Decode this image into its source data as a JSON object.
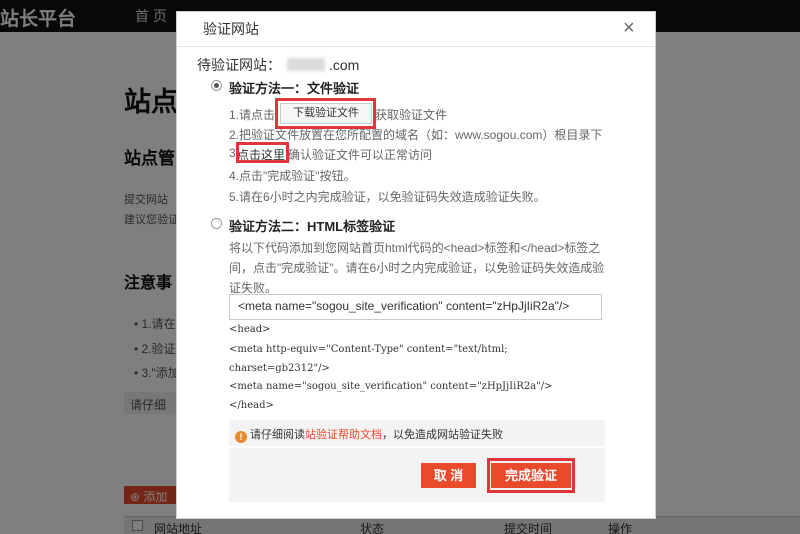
{
  "background": {
    "logo": "站长平台",
    "nav_first": "首 页",
    "heading": "站点",
    "subheading": "站点管",
    "text_line1": "提交网站",
    "text_line2": "建议您验证",
    "notes_heading": "注意事",
    "note_items": [
      "• 1.请在6",
      "• 2.验证站",
      "• 3.\"添加网"
    ],
    "tip": "请仔细",
    "add_button": "⊕ 添加",
    "table_headers": {
      "site": "网站地址",
      "status": "状态",
      "time": "提交时间",
      "action": "操作"
    }
  },
  "modal": {
    "title": "验证网站",
    "close": "×",
    "site_label_prefix": "待验证网站：",
    "site_label_suffix": ".com",
    "method1": {
      "title": "验证方法一：文件验证",
      "step1_prefix": "1.请点击",
      "download_button": "下载验证文件",
      "step1_suffix": "获取验证文件",
      "step2": "2.把验证文件放置在您所配置的域名（如：www.sogou.com）根目录下",
      "step3_number": "3.",
      "click_here": "点击这里",
      "step3_suffix": "确认验证文件可以正常访问",
      "step4": "4.点击\"完成验证\"按钮。",
      "step5": "5.请在6小时之内完成验证，以免验证码失效造成验证失败。"
    },
    "method2": {
      "title": "验证方法二：HTML标签验证",
      "description": "将以下代码添加到您网站首页html代码的<head>标签和</head>标签之间，点击\"完成验证\"。请在6小时之内完成验证，以免验证码失效造成验证失败。",
      "meta_input_value": "<meta name=\"sogou_site_verification\" content=\"zHpJjIiR2a\"/>",
      "code_lines": [
        "<head>",
        "<meta http-equiv=\"Content-Type\" content=\"text/html;",
        "charset=gb2312\"/>",
        "<meta name=\"sogou_site_verification\" content=\"zHpJjIiR2a\"/>",
        "</head>"
      ]
    },
    "notice_prefix": "请仔细阅读",
    "notice_link": "站验证帮助文档",
    "notice_suffix": "，以免造成网站验证失败",
    "cancel_button": "取 消",
    "done_button": "完成验证"
  },
  "colors": {
    "accent": "#e84a2b",
    "highlight_box": "#e0353b",
    "warning": "#e8892f"
  }
}
